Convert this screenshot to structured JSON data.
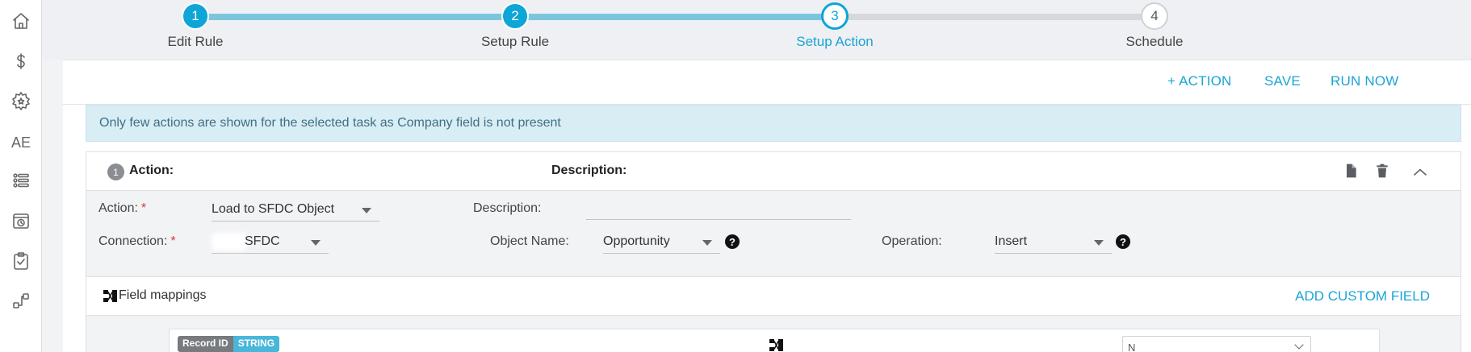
{
  "sidebar": {
    "items": [
      {
        "name": "home-icon"
      },
      {
        "name": "dollar-icon"
      },
      {
        "name": "gear-star-icon"
      },
      {
        "name": "ae-text",
        "text": "AE"
      },
      {
        "name": "list-icon"
      },
      {
        "name": "clock-icon"
      },
      {
        "name": "clipboard-check-icon"
      },
      {
        "name": "flow-icon"
      }
    ]
  },
  "stepper": {
    "steps": [
      {
        "number": "1",
        "label": "Edit Rule",
        "state": "done"
      },
      {
        "number": "2",
        "label": "Setup Rule",
        "state": "done"
      },
      {
        "number": "3",
        "label": "Setup Action",
        "state": "current"
      },
      {
        "number": "4",
        "label": "Schedule",
        "state": "todo"
      }
    ]
  },
  "toolbar": {
    "add_action": "+ ACTION",
    "save": "SAVE",
    "run_now": "RUN NOW"
  },
  "info": {
    "message": "Only few actions are shown for the selected task as Company field is not present"
  },
  "action": {
    "index": "1",
    "header_action_label": "Action:",
    "header_description_label": "Description:",
    "icons": [
      "copy-icon",
      "trash-icon",
      "chevron-up-icon"
    ],
    "form": {
      "action_label": "Action:",
      "action_value": "Load to SFDC Object",
      "description_label": "Description:",
      "description_value": "",
      "connection_label": "Connection:",
      "connection_value": "SFDC",
      "object_name_label": "Object Name:",
      "object_name_value": "Opportunity",
      "operation_label": "Operation:",
      "operation_value": "Insert",
      "required_mark": "*",
      "help_mark": "?"
    },
    "field_mappings": {
      "title": "Field mappings",
      "add_custom_field": "ADD CUSTOM FIELD",
      "rows": [
        {
          "field": "Record ID",
          "type": "STRING",
          "target": "N"
        }
      ]
    }
  },
  "colors": {
    "accent": "#0ea5d7",
    "link": "#1aa4d6",
    "info_bg": "#d9edf5",
    "required": "#d9363e"
  }
}
